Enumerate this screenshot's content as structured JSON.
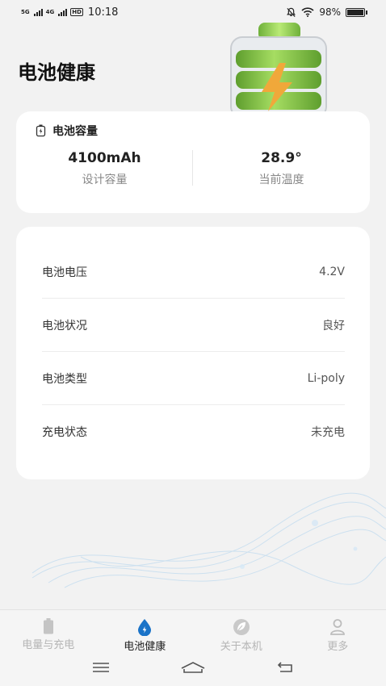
{
  "status_bar": {
    "sim1": "5G",
    "sim2": "4G",
    "hd": "HD",
    "time": "10:18",
    "battery_pct": "98%"
  },
  "header": {
    "title": "电池健康"
  },
  "capacity_card": {
    "heading": "电池容量",
    "capacity_value": "4100mAh",
    "capacity_label": "设计容量",
    "temp_value": "28.9°",
    "temp_label": "当前温度"
  },
  "info_rows": [
    {
      "key": "电池电压",
      "value": "4.2V"
    },
    {
      "key": "电池状况",
      "value": "良好"
    },
    {
      "key": "电池类型",
      "value": "Li-poly"
    },
    {
      "key": "充电状态",
      "value": "未充电"
    }
  ],
  "tabs": [
    {
      "label": "电量与充电",
      "icon": "battery-icon",
      "active": false
    },
    {
      "label": "电池健康",
      "icon": "water-drop-icon",
      "active": true
    },
    {
      "label": "关于本机",
      "icon": "leaf-icon",
      "active": false
    },
    {
      "label": "更多",
      "icon": "person-icon",
      "active": false
    }
  ],
  "colors": {
    "accent": "#1a73c8",
    "battery_green": "#7fc241",
    "bolt": "#f0a83a"
  }
}
